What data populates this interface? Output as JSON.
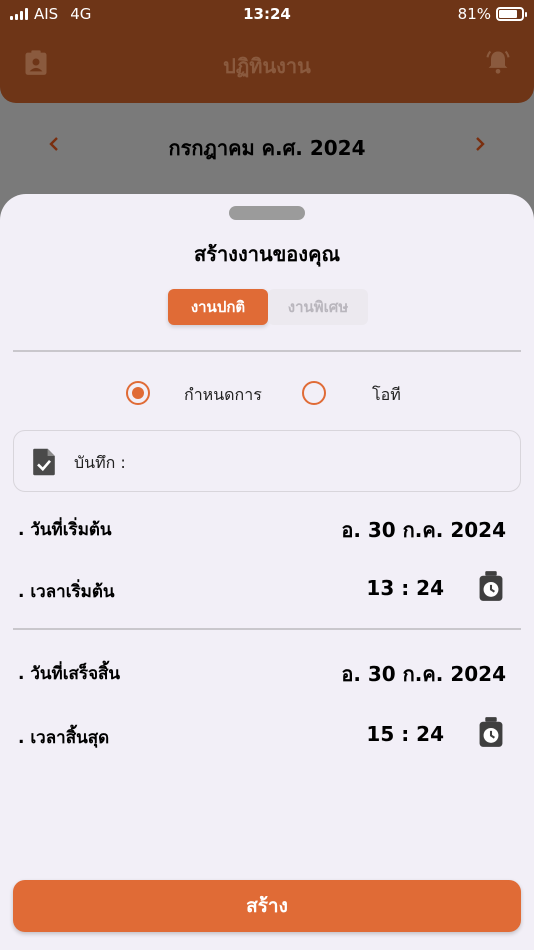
{
  "status_bar": {
    "carrier": "AIS",
    "network": "4G",
    "time": "13:24",
    "battery": "81%",
    "battery_level": 0.81
  },
  "header": {
    "title": "ปฏิทินงาน",
    "left_icon": "clipboard-icon",
    "right_icon": "bell-alarm-icon"
  },
  "month_nav": {
    "label": "กรกฎาคม ค.ศ. 2024"
  },
  "sheet": {
    "title": "สร้างงานของคุณ",
    "tabs": [
      {
        "label": "งานปกติ",
        "active": true
      },
      {
        "label": "งานพิเศษ",
        "active": false
      }
    ],
    "radio_options": [
      {
        "label": "กำหนดการ",
        "selected": true
      },
      {
        "label": "โอที",
        "selected": false
      }
    ],
    "note": {
      "label": "บันทึก :"
    },
    "start_date": {
      "label": ". วันที่เริ่มต้น",
      "value": "อ. 30 ก.ค. 2024"
    },
    "start_time": {
      "label": ". เวลาเริ่มต้น",
      "value": "13 : 24"
    },
    "end_date": {
      "label": ". วันที่เสร็จสิ้น",
      "value": "อ. 30 ก.ค. 2024"
    },
    "end_time": {
      "label": ". เวลาสิ้นสุด",
      "value": "15 : 24"
    },
    "create_label": "สร้าง"
  },
  "colors": {
    "header_bg": "#6e3517",
    "accent": "#e06b36",
    "sheet_bg": "#f2eff7"
  }
}
